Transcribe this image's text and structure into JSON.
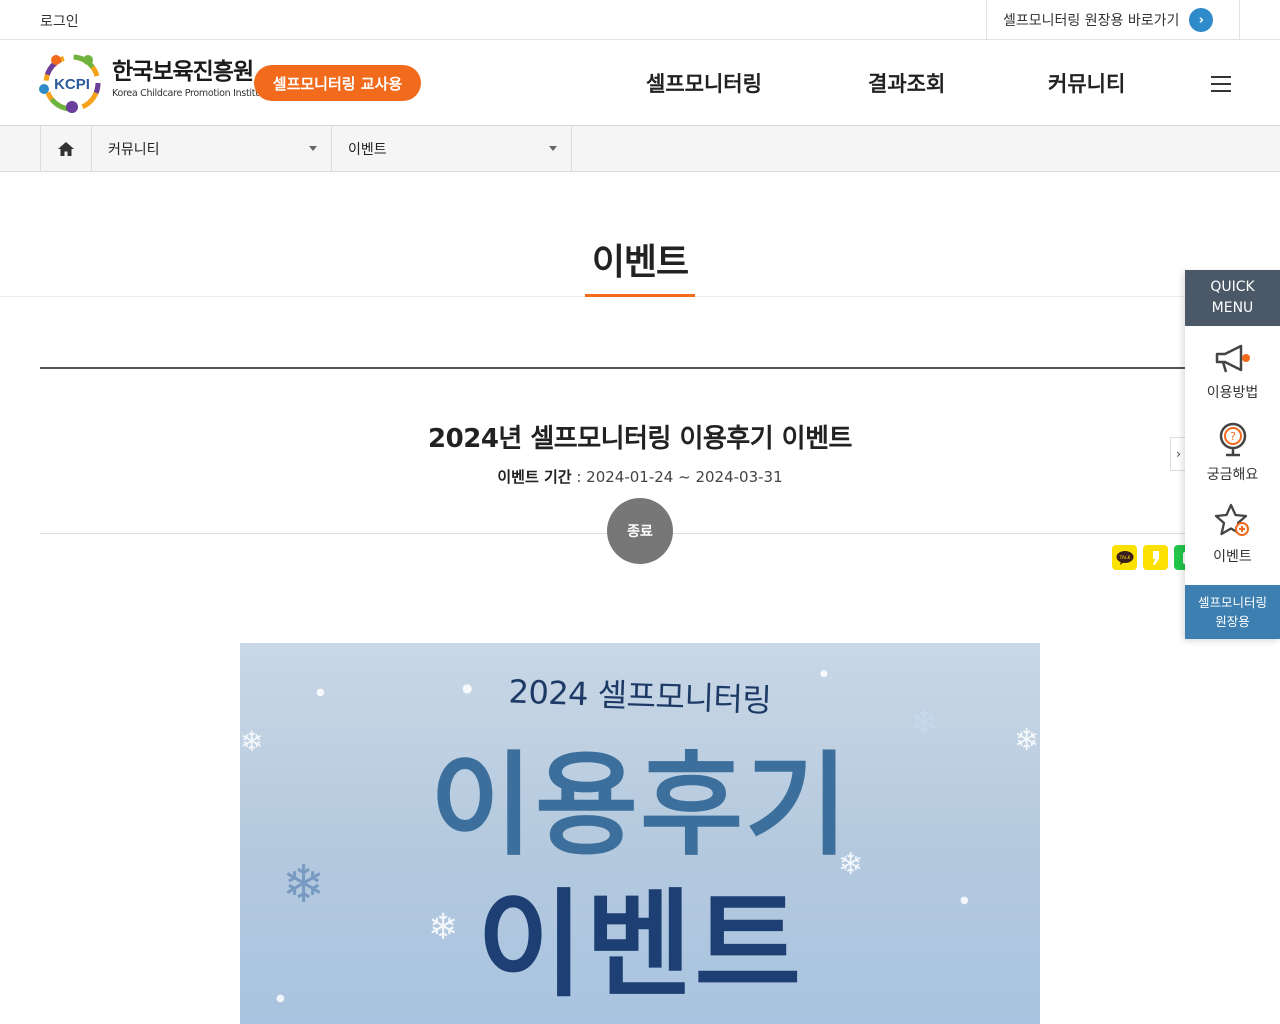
{
  "util": {
    "login": "로그인",
    "owner_link": "셀프모니터링 원장용 바로가기",
    "owner_link_icon": "chevron-right-icon"
  },
  "header": {
    "logo_ko": "한국보육진흥원",
    "logo_en": "Korea Childcare Promotion Institute",
    "logo_mark": "KCPI",
    "teacher_badge": "셀프모니터링 교사용",
    "nav": [
      "셀프모니터링",
      "결과조회",
      "커뮤니티"
    ],
    "accent": "#f26a1b"
  },
  "breadcrumb": {
    "home_icon": "home-icon",
    "depth1": "커뮤니티",
    "depth2": "이벤트"
  },
  "page": {
    "title": "이벤트"
  },
  "post": {
    "title": "2024년 셀프모니터링 이용후기 이벤트",
    "period_label": "이벤트 기간",
    "period_sep": " : ",
    "start": "2024-01-24",
    "tilde": " ~ ",
    "end": "2024-03-31",
    "status": "종료",
    "share": [
      "kakaotalk-icon",
      "kakaostory-icon",
      "band-icon"
    ]
  },
  "banner": {
    "subtitle": "2024 셀프모니터링",
    "line1": "이용후기",
    "line2": "이벤트"
  },
  "quick_menu": {
    "head": [
      "QUICK",
      "MENU"
    ],
    "items": [
      {
        "label": "이용방법",
        "icon": "megaphone-icon"
      },
      {
        "label": "궁금해요",
        "icon": "question-globe-icon"
      },
      {
        "label": "이벤트",
        "icon": "star-plus-icon"
      }
    ],
    "owner": [
      "셀프모니터링",
      "원장용"
    ],
    "owner_color": "#3d7fb1"
  }
}
